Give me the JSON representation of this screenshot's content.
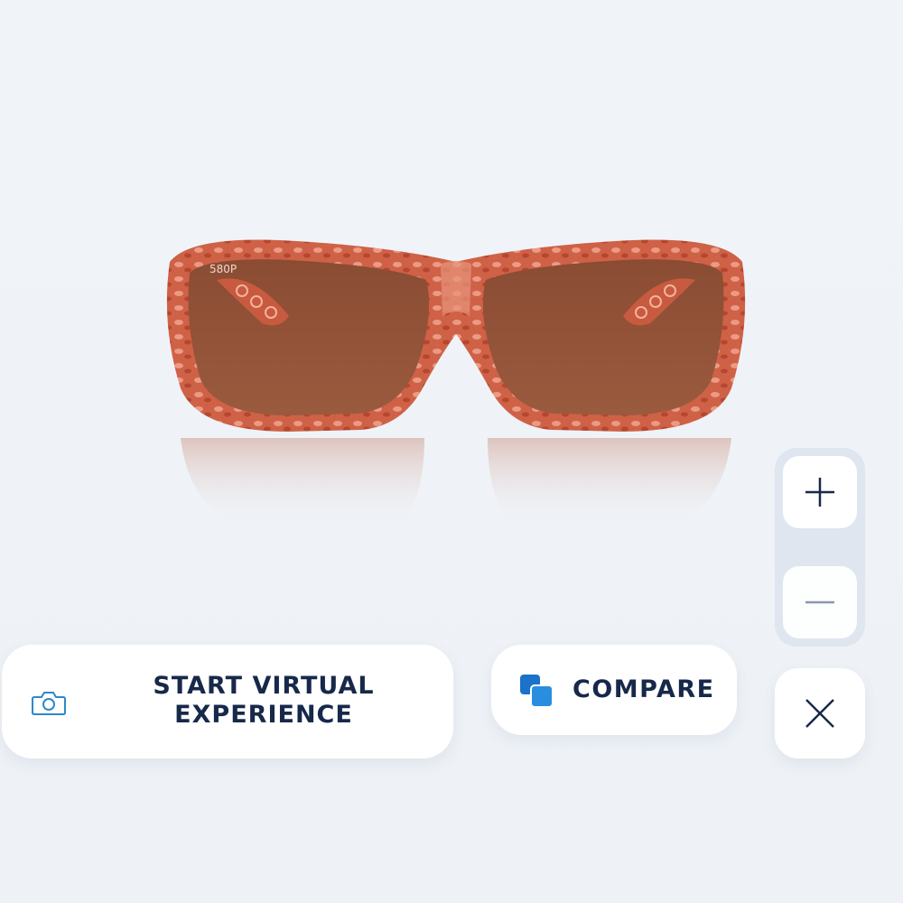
{
  "product": {
    "lens_text": "580P",
    "colors": {
      "frame": "#c9583e",
      "frame_light": "#e8947c",
      "lens": "#8c4e34"
    }
  },
  "actions": {
    "virtual_experience": {
      "label": "START VIRTUAL EXPERIENCE",
      "icon": "camera-icon"
    },
    "compare": {
      "label": "COMPARE",
      "icon": "compare-icon",
      "icon_color": "#1a73c9"
    }
  },
  "zoom": {
    "zoom_in_icon": "plus-icon",
    "zoom_out_icon": "minus-icon"
  },
  "close": {
    "icon": "close-icon"
  },
  "theme": {
    "text": "#17294a",
    "background": "#eef2f7"
  }
}
